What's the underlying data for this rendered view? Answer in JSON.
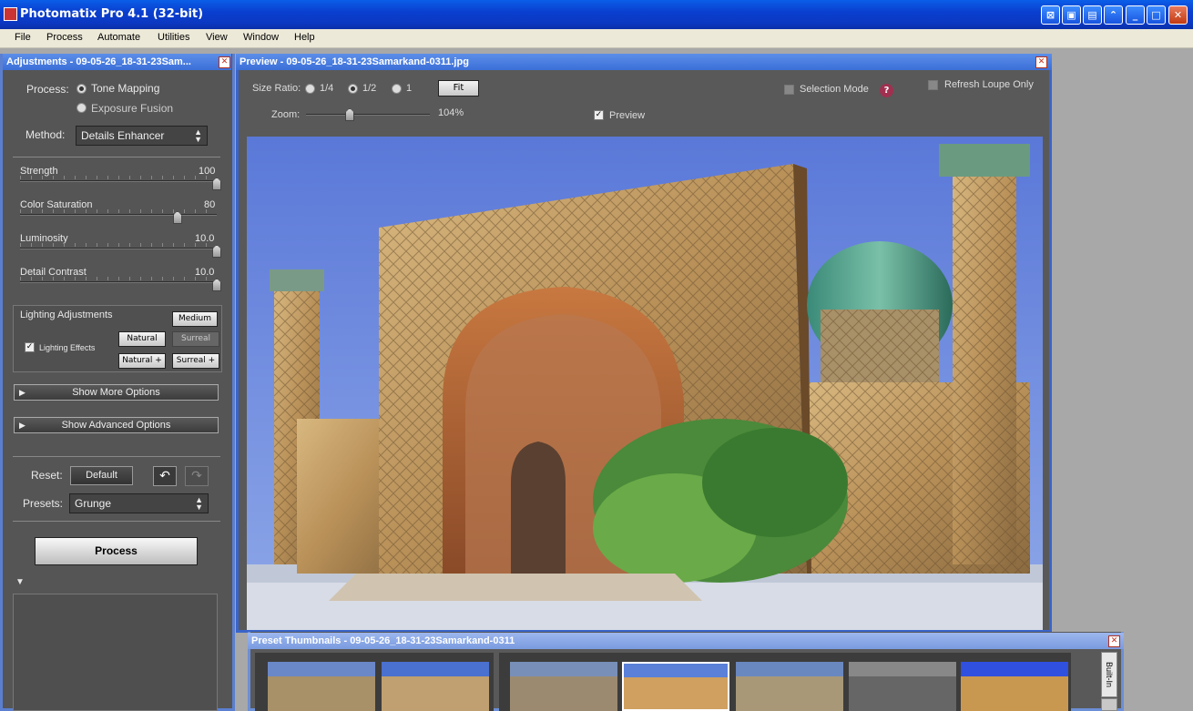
{
  "window": {
    "title": "Photomatix Pro 4.1 (32-bit)"
  },
  "menu": [
    "File",
    "Process",
    "Automate",
    "Utilities",
    "View",
    "Window",
    "Help"
  ],
  "adjustments": {
    "title": "Adjustments - 09-05-26_18-31-23Sam...",
    "process_label": "Process:",
    "process_options": [
      "Tone Mapping",
      "Exposure Fusion"
    ],
    "method_label": "Method:",
    "method_value": "Details Enhancer",
    "sliders": [
      {
        "label": "Strength",
        "value": "100",
        "fraction": 1.0
      },
      {
        "label": "Color Saturation",
        "value": "80",
        "fraction": 0.8
      },
      {
        "label": "Luminosity",
        "value": "10.0",
        "fraction": 1.0
      },
      {
        "label": "Detail Contrast",
        "value": "10.0",
        "fraction": 1.0
      }
    ],
    "lighting": {
      "label": "Lighting Adjustments",
      "effects_label": "Lighting Effects",
      "buttons": [
        "Medium",
        "Natural",
        "Surreal",
        "Natural +",
        "Surreal +"
      ]
    },
    "more_options": "Show More Options",
    "advanced_options": "Show Advanced Options",
    "reset_label": "Reset:",
    "default_button": "Default",
    "presets_label": "Presets:",
    "presets_value": "Grunge",
    "process_button": "Process"
  },
  "preview": {
    "title": "Preview - 09-05-26_18-31-23Samarkand-0311.jpg",
    "size_ratio_label": "Size Ratio:",
    "ratios": [
      "1/4",
      "1/2",
      "1"
    ],
    "fit_button": "Fit",
    "selection_mode": "Selection Mode",
    "refresh_loupe": "Refresh Loupe Only",
    "zoom_label": "Zoom:",
    "zoom_value": "104%",
    "preview_check": "Preview"
  },
  "presets": {
    "title": "Preset Thumbnails - 09-05-26_18-31-23Samarkand-0311",
    "tab_builtin": "Built-In"
  },
  "colors": {
    "accent": "#3a64c8",
    "titlebar": "#0a3fcf",
    "panel_bg": "#555555"
  }
}
